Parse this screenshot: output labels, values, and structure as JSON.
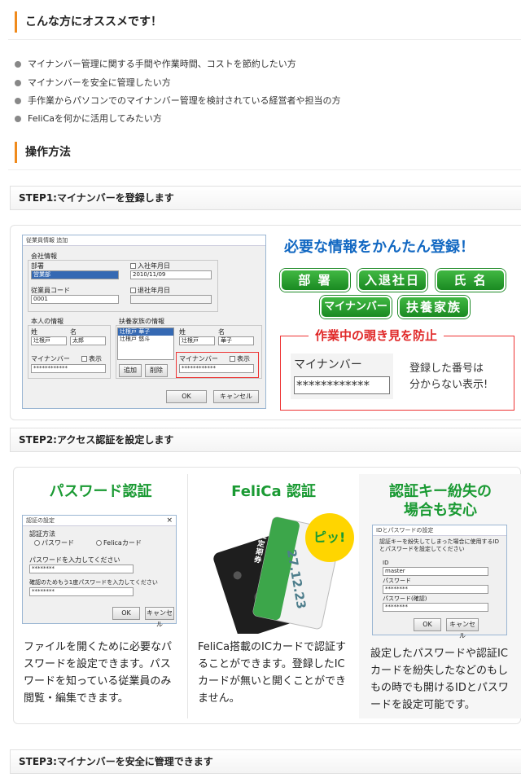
{
  "recommend": {
    "heading": "こんな方にオススメです！",
    "bullets": [
      "マイナンバー管理に関する手間や作業時間、コストを節約したい方",
      "マイナンバーを安全に管理したい方",
      "手作業からパソコンでのマイナンバー管理を検討されている経営者や担当の方",
      "FeliCaを何かに活用してみたい方"
    ]
  },
  "operation": {
    "heading": "操作方法"
  },
  "steps": [
    "STEP1:マイナンバーを登録します",
    "STEP2:アクセス認証を設定します",
    "STEP3:マイナンバーを安全に管理できます"
  ],
  "step1": {
    "window": {
      "title": "従業員情報 追加",
      "company_group": "会社情報",
      "dept_label": "部署",
      "dept_value": "営業部",
      "join_label": "入社年月日",
      "join_value": "2010/11/09",
      "empno_label": "従業員コード",
      "empno_value": "0001",
      "leave_label": "退社年月日",
      "self_group": "本人の情報",
      "sei_label": "姓",
      "mei_label": "名",
      "sei_value": "辻根戸",
      "mei_value": "太郎",
      "mynumber_label": "マイナンバー",
      "show_label": "表示",
      "mynumber_value": "************",
      "family_group": "扶養家族の情報",
      "family_items": [
        "辻根戸 華子",
        "辻根戸 悠斗"
      ],
      "fam_sei_label": "姓",
      "fam_mei_label": "名",
      "fam_sei_value": "辻根戸",
      "fam_mei_value": "華子",
      "fam_mynumber_label": "マイナンバー",
      "fam_show_label": "表示",
      "fam_mynumber_value": "************",
      "add_button": "追加",
      "delete_button": "削除",
      "ok_button": "OK",
      "cancel_button": "キャンセル"
    },
    "promo_title": "必要な情報をかんたん登録！",
    "tags": [
      "部 署",
      "入退社日",
      "氏 名",
      "マイナンバー",
      "扶養家族"
    ],
    "peek_title": "作業中の覗き見を防止",
    "peek_label": "マイナンバー",
    "peek_value": "************",
    "peek_note": "登録した番号は\n分からない表示!"
  },
  "step2": {
    "password": {
      "title": "パスワード認証",
      "window_title": "認証の設定",
      "method_label": "認証方法",
      "opt_password": "パスワード",
      "opt_felica": "Felicaカード",
      "pw_label": "パスワードを入力してください",
      "pw_value": "********",
      "confirm_label": "確認のためもう1度パスワードを入力してください",
      "confirm_value": "********",
      "ok_button": "OK",
      "cancel_button": "キャンセル",
      "desc": "ファイルを開くために必要なパスワードを設定できます。パスワードを知っている従業員のみ閲覧・編集できます。"
    },
    "felica": {
      "title": "FeliCa 認証",
      "bubble": "ピッ!",
      "card_text": "IC 定期券",
      "card_num": "27.12.23",
      "desc": "FeliCa搭載のICカードで認証することができます。登録したICカードが無いと開くことができません。"
    },
    "lost": {
      "title": "認証キー紛失の\n場合も安心",
      "window_title": "IDとパスワードの設定",
      "note": "認証キーを紛失してしまった場合に使用するIDとパスワードを設定してください",
      "id_label": "ID",
      "id_value": "master",
      "pw_label": "パスワード",
      "pw_value": "********",
      "confirm_label": "パスワード(確認)",
      "confirm_value": "********",
      "ok_button": "OK",
      "cancel_button": "キャンセル",
      "desc": "設定したパスワードや認証ICカードを紛失したなどのもしもの時でも開けるIDとパスワードを設定可能です。"
    }
  }
}
